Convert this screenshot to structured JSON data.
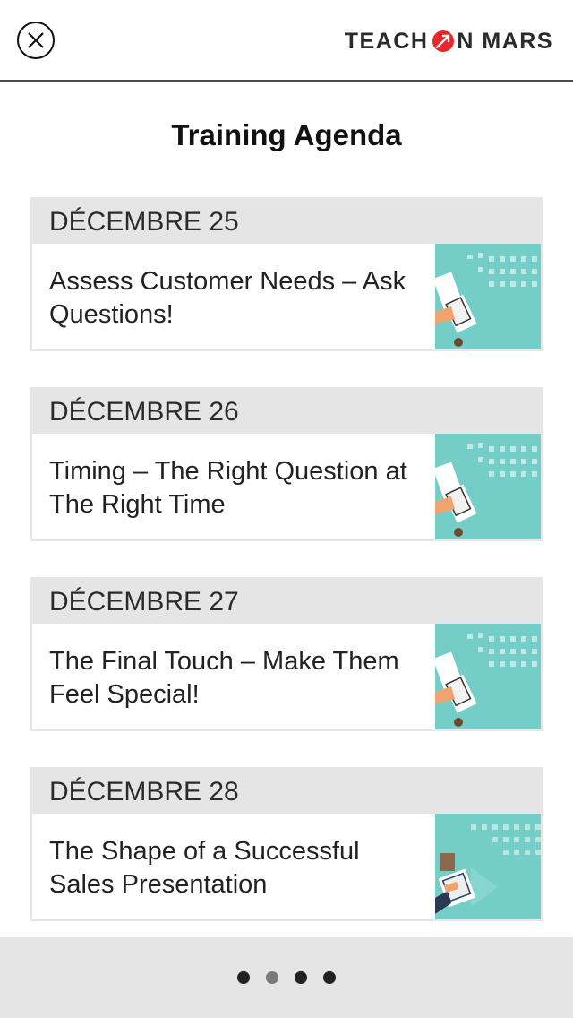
{
  "header": {
    "close_icon": "close-icon",
    "logo_left": "TEACH",
    "logo_right": "N MARS",
    "logo_icon": "rocket-icon",
    "brand_red": "#e8262b"
  },
  "page": {
    "title": "Training Agenda"
  },
  "agenda": [
    {
      "date": "DÉCEMBRE 25",
      "title": "Assess Customer Needs – Ask Questions!"
    },
    {
      "date": "DÉCEMBRE 26",
      "title": "Timing – The Right Question at The Right Time"
    },
    {
      "date": "DÉCEMBRE 27",
      "title": "The Final Touch – Make Them Feel Special!"
    },
    {
      "date": "DÉCEMBRE 28",
      "title": "The Shape of a Successful Sales Presentation"
    }
  ],
  "pagination": {
    "count": 4,
    "active_index": 1
  },
  "colors": {
    "thumbnail_bg": "#74cdc6",
    "date_bar": "#e5e5e5"
  }
}
